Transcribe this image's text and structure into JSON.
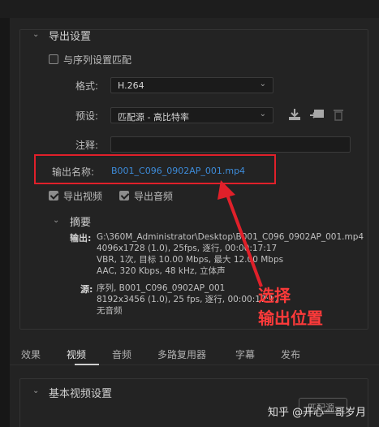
{
  "export_settings": {
    "title": "导出设置",
    "match_sequence_label": "与序列设置匹配",
    "format_label": "格式:",
    "format_value": "H.264",
    "preset_label": "预设:",
    "preset_value": "匹配源 - 高比特率",
    "comments_label": "注释:",
    "comments_value": "",
    "output_name_label": "输出名称:",
    "output_name_value": "B001_C096_0902AP_001.mp4",
    "export_video_label": "导出视频",
    "export_audio_label": "导出音频",
    "export_video_checked": true,
    "export_audio_checked": true,
    "match_sequence_checked": false
  },
  "summary": {
    "title": "摘要",
    "output_key": "输出:",
    "output_lines": [
      "G:\\360M_Administrator\\Desktop\\B001_C096_0902AP_001.mp4",
      "4096x1728 (1.0), 25fps, 逐行, 00:00:17:17",
      "VBR, 1次, 目标 10.00 Mbps, 最大 12.00 Mbps",
      "AAC, 320 Kbps, 48 kHz, 立体声"
    ],
    "source_key": "源:",
    "source_lines": [
      "序列, B001_C096_0902AP_001",
      "8192x3456 (1.0), 25 fps, 逐行, 00:00:17:17",
      "无音频"
    ]
  },
  "annotation": {
    "line1": "选择",
    "line2": "输出位置",
    "color": "#ff3a3a"
  },
  "tabs": [
    {
      "label": "效果",
      "active": false
    },
    {
      "label": "视频",
      "active": true
    },
    {
      "label": "音频",
      "active": false
    },
    {
      "label": "多路复用器",
      "active": false
    },
    {
      "label": "字幕",
      "active": false
    },
    {
      "label": "发布",
      "active": false
    }
  ],
  "basic_video": {
    "title": "基本视频设置",
    "match_source_button": "匹配源"
  },
  "watermark": "知乎 @开心一哥岁月",
  "icons": {
    "save_preset": "save-preset-icon",
    "import_preset": "import-preset-icon",
    "delete_preset": "trash-icon"
  }
}
